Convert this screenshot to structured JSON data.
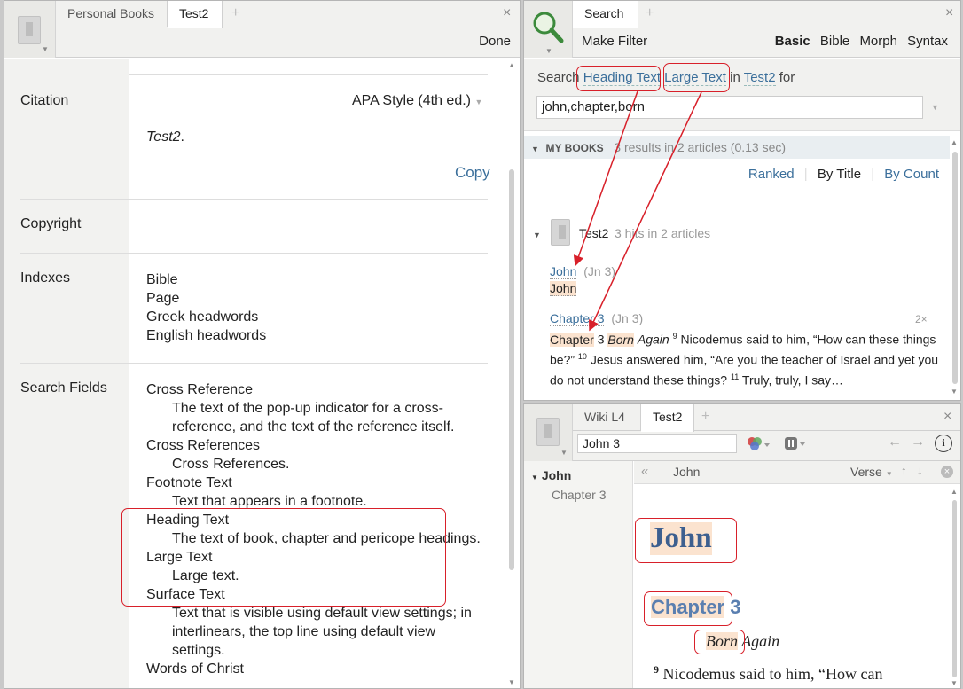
{
  "left": {
    "tabs": [
      {
        "label": "Personal Books"
      },
      {
        "label": "Test2"
      }
    ],
    "done_label": "Done",
    "citation": {
      "label": "Citation",
      "style": "APA Style (4th ed.)",
      "text": "Test2",
      "copy": "Copy"
    },
    "copyright_label": "Copyright",
    "indexes": {
      "label": "Indexes",
      "items": [
        "Bible",
        "Page",
        "Greek headwords",
        "English headwords"
      ]
    },
    "search_fields": {
      "label": "Search Fields",
      "items": [
        {
          "name": "Cross Reference",
          "desc": "The text of the pop-up indicator for a cross-reference, and the text of the reference itself."
        },
        {
          "name": "Cross References",
          "desc": "Cross References."
        },
        {
          "name": "Footnote Text",
          "desc": "Text that appears in a footnote."
        },
        {
          "name": "Heading Text",
          "desc": "The text of book, chapter and pericope headings."
        },
        {
          "name": "Large Text",
          "desc": "Large text."
        },
        {
          "name": "Surface Text",
          "desc": "Text that is visible using default view settings; in interlinears, the top line using default view settings."
        },
        {
          "name": "Words of Christ",
          "desc": ""
        }
      ]
    }
  },
  "search": {
    "tab": "Search",
    "make_filter": "Make Filter",
    "modes": [
      "Basic",
      "Bible",
      "Morph",
      "Syntax"
    ],
    "query_prefix": "Search",
    "field1": "Heading Text",
    "field2": "Large Text",
    "in_word": "in",
    "resource": "Test2",
    "for_word": "for",
    "query": "john,chapter,born",
    "section_label": "MY BOOKS",
    "summary": "3 results in 2 articles (0.13 sec)",
    "sorts": [
      "Ranked",
      "By Title",
      "By Count"
    ],
    "result_book": "Test2",
    "result_book_hits": "3 hits in 2 articles",
    "hit1": {
      "title": "John",
      "ref": "(Jn 3)",
      "snippet": "John"
    },
    "hit2": {
      "title": "Chapter 3",
      "ref": "(Jn 3)",
      "count": "2×",
      "w1": "Chapter",
      "w1b": "3",
      "w2": "Born",
      "w2b": "Again",
      "line1": "Nicodemus said to him, “How can these",
      "line2a": "things be?”",
      "line2b": "Jesus answered him, “Are you the teacher of Israel",
      "line3": "and yet you do not understand these things?",
      "line3b": "Truly, truly, I say…",
      "sup9": "9",
      "sup10": "10",
      "sup11": "11"
    }
  },
  "reader": {
    "tabs": [
      {
        "label": "Wiki L4"
      },
      {
        "label": "Test2"
      }
    ],
    "ref_input": "John 3",
    "toc": {
      "book": "John",
      "chapter": "Chapter 3"
    },
    "breadcrumb": "John",
    "verse_label": "Verse",
    "heading": "John",
    "chapter_word": "Chapter",
    "chapter_num": "3",
    "born": "Born",
    "again": "Again",
    "vnum": "9",
    "verse_text": "Nicodemus said to him, “How can"
  }
}
